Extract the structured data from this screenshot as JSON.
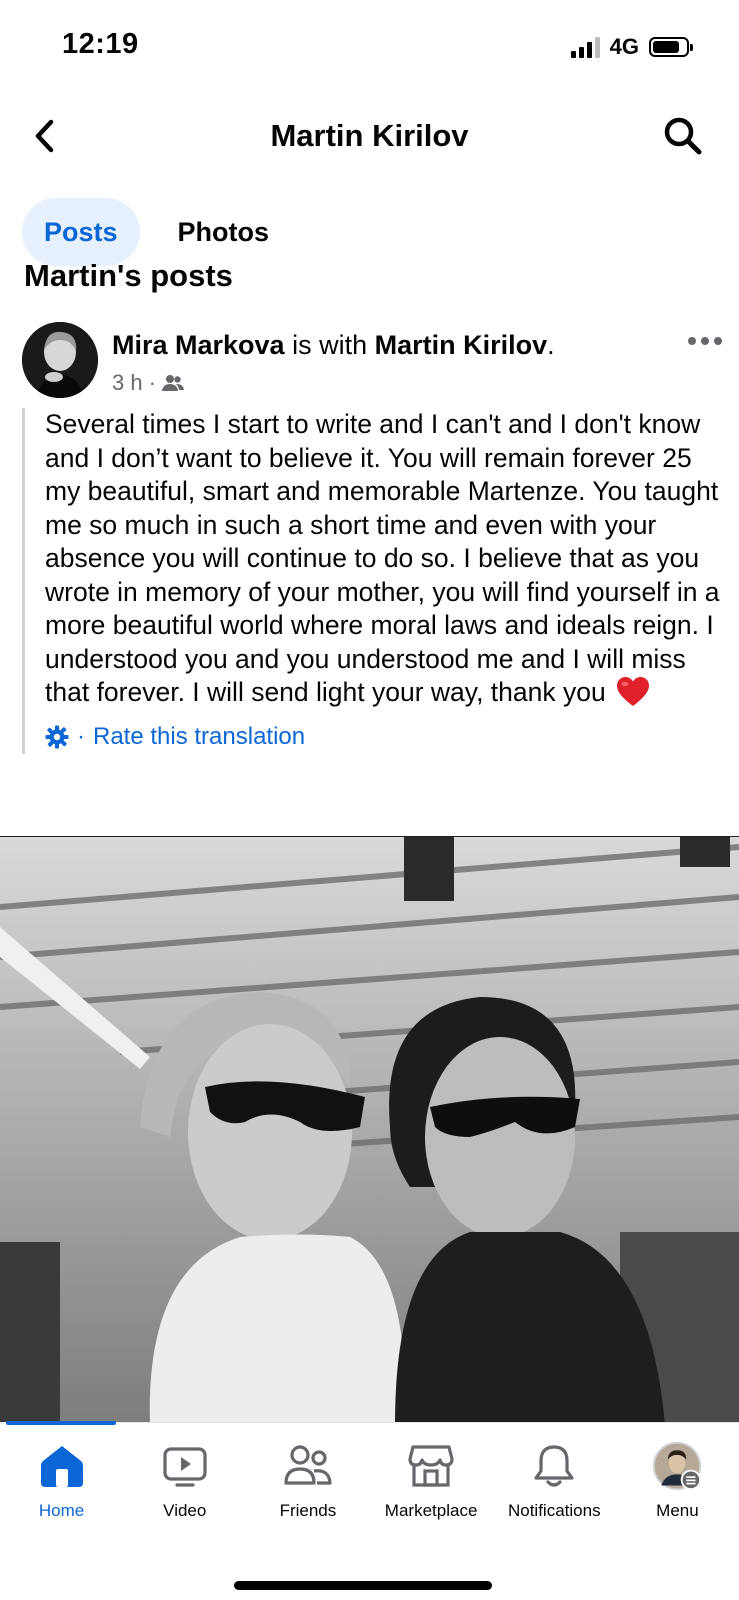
{
  "status": {
    "time": "12:19",
    "network": "4G"
  },
  "header": {
    "title": "Martin Kirilov"
  },
  "tabs": [
    {
      "label": "Posts",
      "active": true
    },
    {
      "label": "Photos",
      "active": false
    }
  ],
  "section_title": "Martin's posts",
  "post": {
    "author": "Mira Markova",
    "with_text": " is with ",
    "tagged": "Martin Kirilov",
    "end": ".",
    "time": "3 h",
    "audience_icon": "friends-icon",
    "text": "Several times I start to write and I can't and I don't know and I don’t want to believe it. You will remain forever 25 my beautiful, smart and memorable Martenze. You taught me so much in such a short time and even with your absence you will continue to do so. I believe that as you wrote in memory of your mother, you will find yourself in a more beautiful world where moral laws and ideals reign. I understood you and you understood me and I will miss that forever. I will send light your way, thank you",
    "translation_link": "Rate this translation",
    "translation_separator": "·"
  },
  "bottom_nav": [
    {
      "label": "Home",
      "icon": "home-icon",
      "active": true
    },
    {
      "label": "Video",
      "icon": "video-icon",
      "active": false
    },
    {
      "label": "Friends",
      "icon": "friends-icon",
      "active": false
    },
    {
      "label": "Marketplace",
      "icon": "marketplace-icon",
      "active": false
    },
    {
      "label": "Notifications",
      "icon": "bell-icon",
      "active": false
    },
    {
      "label": "Menu",
      "icon": "profile-avatar",
      "active": false
    }
  ],
  "colors": {
    "accent": "#0b66d6",
    "tab_bg": "#e7f0fd",
    "muted": "#65676b"
  }
}
